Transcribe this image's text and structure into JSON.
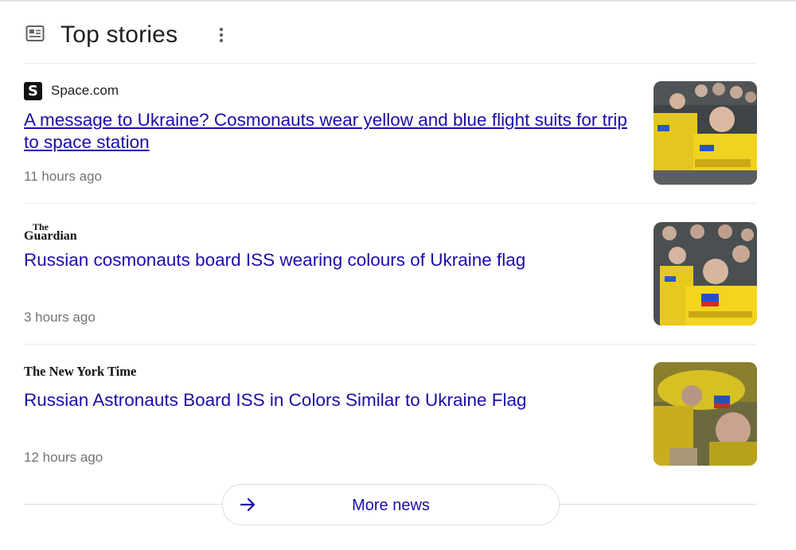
{
  "header": {
    "title": "Top stories",
    "icon": "newspaper-icon",
    "menu_icon": "more-vert-icon"
  },
  "colors": {
    "link": "#1a0dab",
    "meta": "#70757a",
    "title": "#202124",
    "divider": "#e8eaed"
  },
  "stories": [
    {
      "source": "Space.com",
      "source_logo": "S",
      "headline": "A message to Ukraine? Cosmonauts wear yellow and blue flight suits for trip to space station",
      "time": "11 hours ago",
      "visited": true
    },
    {
      "source": "The Guardian",
      "headline": "Russian cosmonauts board ISS wearing colours of Ukraine flag",
      "time": "3 hours ago",
      "visited": false
    },
    {
      "source": "The New York Times",
      "headline": "Russian Astronauts Board ISS in Colors Similar to Ukraine Flag",
      "time": "12 hours ago",
      "visited": false
    }
  ],
  "more": {
    "label": "More news",
    "icon": "arrow-right-icon"
  }
}
